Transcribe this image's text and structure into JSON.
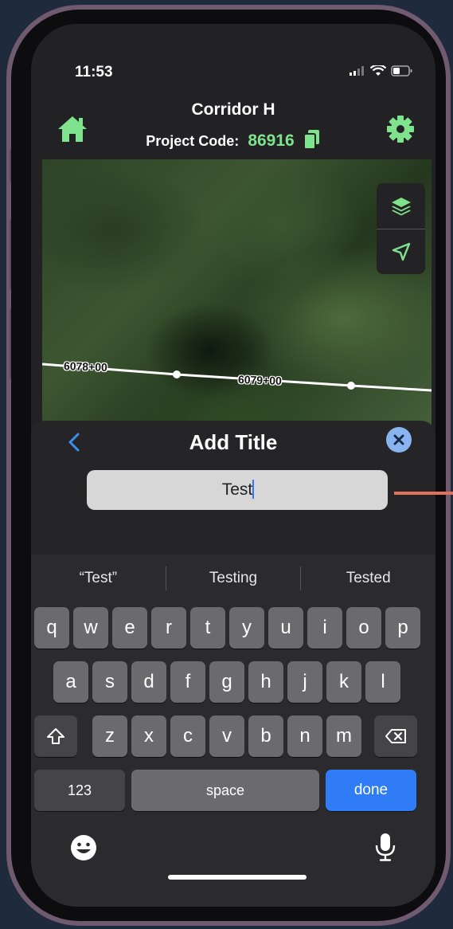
{
  "status_bar": {
    "time": "11:53"
  },
  "header": {
    "title": "Corridor H",
    "project_code_label": "Project Code:",
    "project_code_value": "86916",
    "accent_color": "#7fe38d"
  },
  "map": {
    "stations": [
      "6078+00",
      "6079+00"
    ],
    "tools": [
      "layers-icon",
      "navigation-arrow-icon"
    ]
  },
  "sheet": {
    "title": "Add Title",
    "input_value": "Test"
  },
  "keyboard": {
    "suggestions": [
      "“Test”",
      "Testing",
      "Tested"
    ],
    "row1": [
      "q",
      "w",
      "e",
      "r",
      "t",
      "y",
      "u",
      "i",
      "o",
      "p"
    ],
    "row2": [
      "a",
      "s",
      "d",
      "f",
      "g",
      "h",
      "j",
      "k",
      "l"
    ],
    "row3": [
      "z",
      "x",
      "c",
      "v",
      "b",
      "n",
      "m"
    ],
    "numbers_label": "123",
    "space_label": "space",
    "done_label": "done",
    "done_color": "#2f7cf6"
  }
}
